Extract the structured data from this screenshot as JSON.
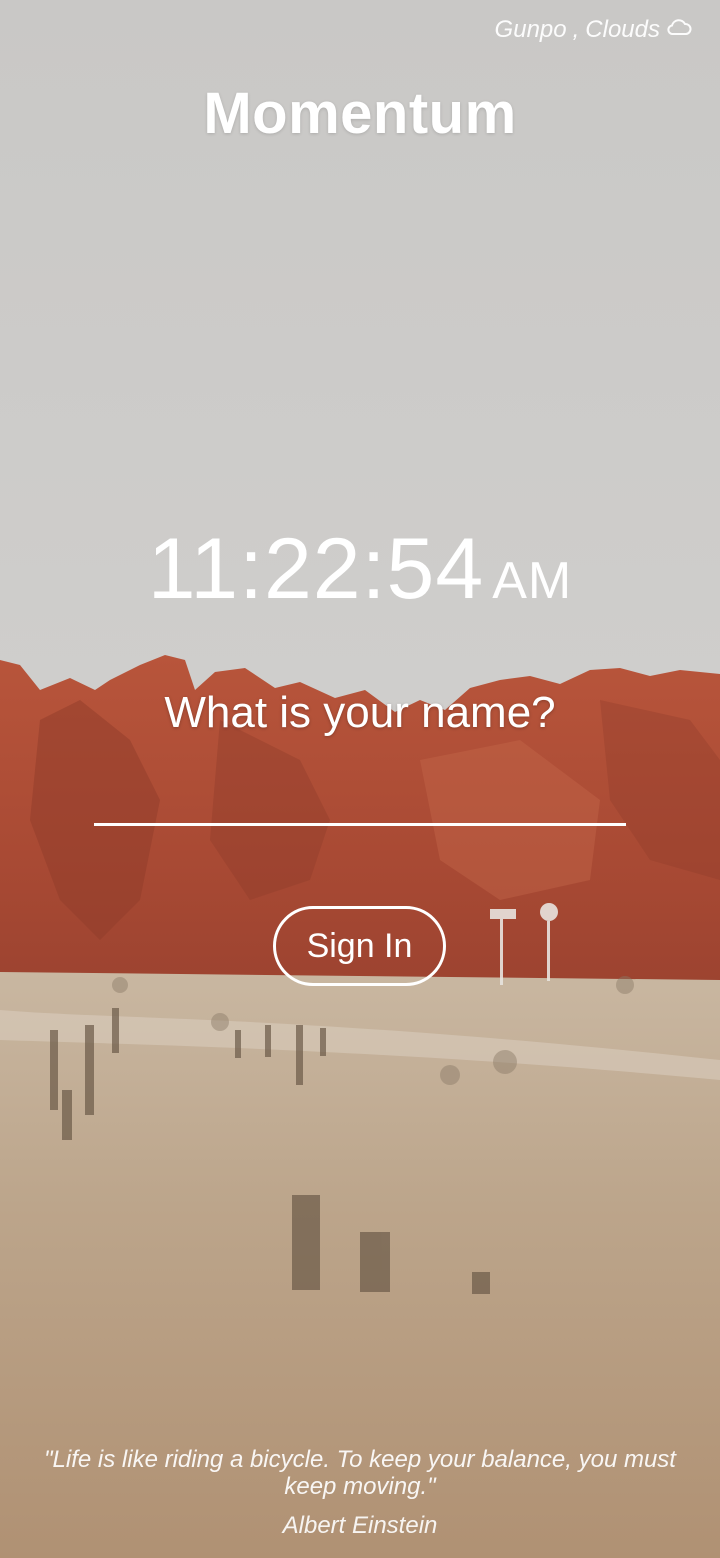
{
  "weather": {
    "location": "Gunpo",
    "condition": "Clouds",
    "separator": ", ",
    "icon": "cloud-icon"
  },
  "app": {
    "title": "Momentum"
  },
  "clock": {
    "time": "11:22:54",
    "period": "AM"
  },
  "greeting": {
    "question": "What is your name?"
  },
  "name_input": {
    "value": "",
    "placeholder": ""
  },
  "signin": {
    "label": "Sign In"
  },
  "quote": {
    "text": "\"Life is like riding a bicycle. To keep your balance, you must keep moving.\"",
    "author": "Albert Einstein"
  },
  "colors": {
    "sky": "#cdcccb",
    "rock": "#b5543c",
    "ground": "#b79e84",
    "text": "#ffffff"
  }
}
